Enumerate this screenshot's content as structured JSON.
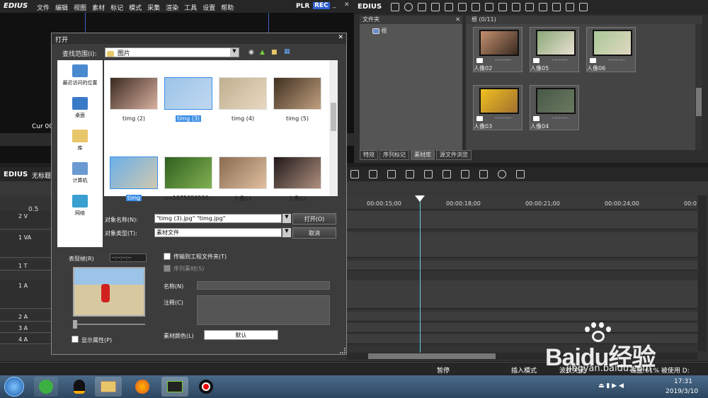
{
  "player": {
    "logo": "EDIUS",
    "menu": [
      "文件",
      "编辑",
      "视图",
      "素材",
      "标记",
      "模式",
      "采集",
      "渲染",
      "工具",
      "设置",
      "帮助"
    ],
    "plr": "PLR",
    "rec": "REC",
    "cur": "Cur 00"
  },
  "bin": {
    "logo": "EDIUS",
    "folder_header": "文件夹",
    "root": "根",
    "clip_header": "根 (0/11)",
    "clips": [
      {
        "name": "人像02",
        "tc": "--:--:--:--"
      },
      {
        "name": "人像05",
        "tc": "--:--:--:--"
      },
      {
        "name": "人像06",
        "tc": "--:--:--:--"
      },
      {
        "name": "人像03",
        "tc": "--:--:--:--"
      },
      {
        "name": "人像04",
        "tc": "--:--:--:--"
      }
    ],
    "tabs": [
      "特效",
      "序列标记",
      "素材库",
      "源文件浏览"
    ]
  },
  "timeline": {
    "logo": "EDIUS",
    "title": "无标题",
    "zoom": "0.5",
    "ruler": [
      "00:00:15;00",
      "00:00:18;00",
      "00:00:21;00",
      "00:00:24;00",
      "00:0"
    ],
    "tracks": [
      "2 V",
      "1 VA",
      "1 T",
      "1 A",
      "2 A",
      "3 A",
      "4 A"
    ]
  },
  "dialog": {
    "title": "打开",
    "lookin_label": "查找范围(I):",
    "lookin_value": "图片",
    "places": [
      "最近访问的位置",
      "桌面",
      "库",
      "计算机",
      "网络"
    ],
    "files": [
      "timg (2)",
      "timg (3)",
      "timg (4)",
      "timg (5)",
      "timg",
      "u=1975359590...",
      "人像01",
      "人像02"
    ],
    "name_label": "对象名称(N):",
    "name_value": "\"timg (3).jpg\" \"timg.jpg\"",
    "type_label": "对象类型(T):",
    "type_value": "素材文件",
    "open": "打开(O)",
    "cancel": "取消",
    "preview_label": "表现帧(R)",
    "preview_tc": "--:--:--:--",
    "show_props": "显示属性(P)",
    "transfer": "传输到工程文件夹(T)",
    "sequence": "序列素材(S)",
    "name_field": "名称(N)",
    "note_field": "注释(C)",
    "color_label": "素材颜色(L)",
    "color_value": "默认"
  },
  "status": {
    "pause": "暂停",
    "insert": "插入模式",
    "ripple": "波纹关闭",
    "disk": "磁盘:61% 被使用 D:"
  },
  "taskbar": {
    "time": "17:31",
    "date": "2019/3/10"
  },
  "watermark": {
    "brand": "Baidu经验",
    "url": "jingyan.baidu.com"
  }
}
